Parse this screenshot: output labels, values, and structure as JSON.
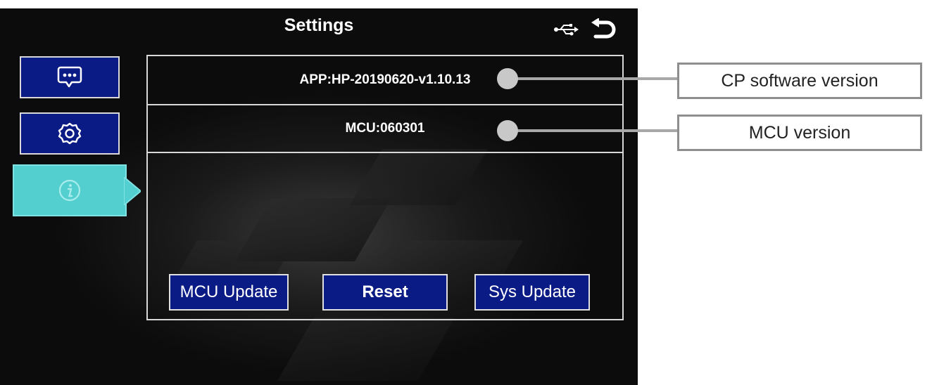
{
  "header": {
    "title": "Settings",
    "usb_icon": "usb-icon",
    "back_icon": "back-arrow-icon"
  },
  "sidebar": {
    "items": [
      {
        "name": "messages",
        "icon": "chat-bubble-icon",
        "active": false
      },
      {
        "name": "settings",
        "icon": "gear-icon",
        "active": false
      },
      {
        "name": "info",
        "icon": "info-icon",
        "active": true
      }
    ],
    "active_color": "#53cfcf",
    "button_color": "#0a1b86"
  },
  "info": {
    "app_version": "APP:HP-20190620-v1.10.13",
    "mcu_version": "MCU:060301"
  },
  "actions": {
    "mcu_update_label": "MCU Update",
    "reset_label": "Reset",
    "sys_update_label": "Sys Update"
  },
  "annotations": {
    "cp_software_version": "CP software version",
    "mcu_version": "MCU version"
  }
}
